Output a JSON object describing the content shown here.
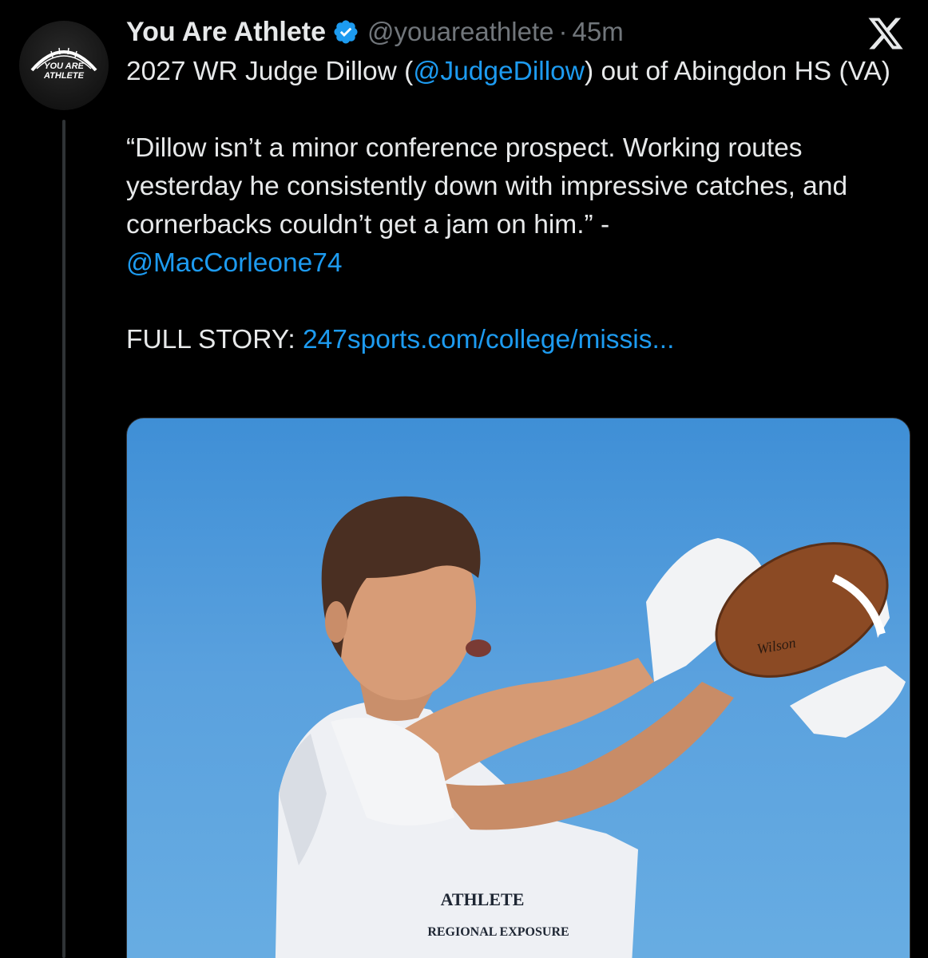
{
  "post": {
    "author": {
      "display_name": "You Are Athlete",
      "handle": "@youareathlete",
      "separator": "·",
      "timestamp": "45m",
      "verified": true,
      "avatar_text_line1": "YOU ARE",
      "avatar_text_line2": "ATHLETE"
    },
    "platform_icon": "x-logo-icon",
    "text": {
      "line1_prefix": "2027 WR Judge Dillow (",
      "line1_mention": "@JudgeDillow",
      "line1_suffix": ") out of Abingdon HS (VA)",
      "quote": "“Dillow isn’t a minor conference prospect. Working routes yesterday he consistently down with impressive catches, and cornerbacks couldn’t get a jam on him.” -",
      "quote_mention": "@MacCorleone74",
      "story_label": "FULL STORY: ",
      "story_link": "247sports.com/college/missis..."
    },
    "media": {
      "shirt_text_line1": "ATHLETE",
      "shirt_text_line2": "REGIONAL EXPOSURE",
      "ball_brand": "Wilson"
    },
    "colors": {
      "background": "#000000",
      "text": "#e7e9ea",
      "secondary": "#71767b",
      "link": "#1d9bf0",
      "verified": "#1d9bf0",
      "sky": "#5aa1de"
    }
  }
}
